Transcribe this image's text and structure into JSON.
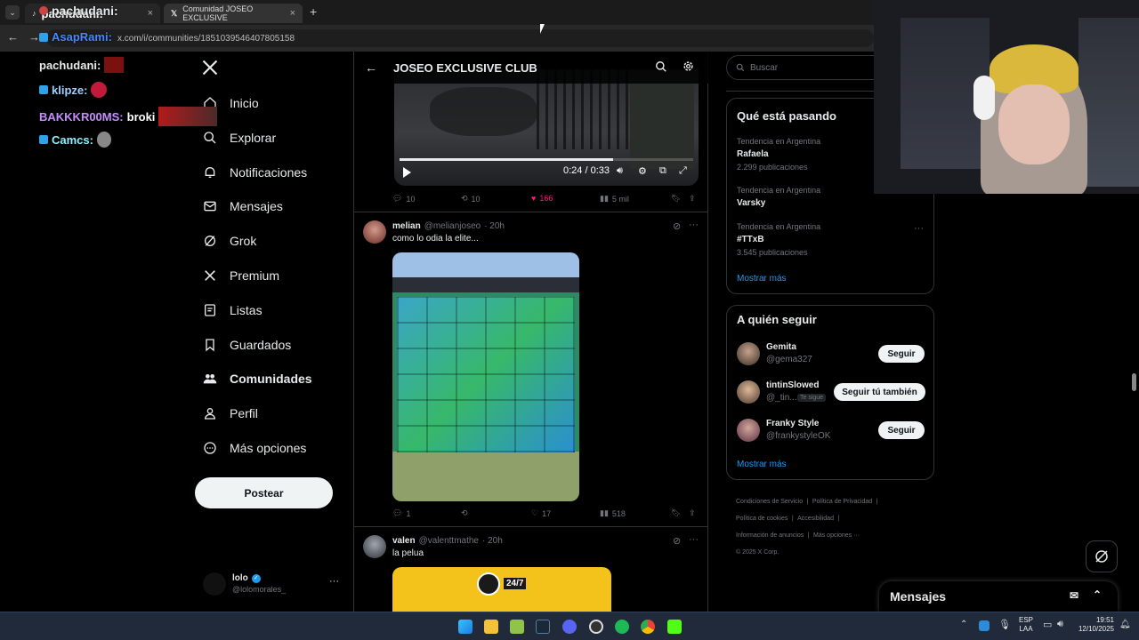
{
  "browser": {
    "tabs": [
      {
        "label": "pachudani:"
      },
      {
        "label": "Comunidad JOSEO EXCLUSIVE"
      }
    ],
    "new_tab": "+",
    "url": "x.com/i/communities/1851039546407805158"
  },
  "sidebar": {
    "logo": "X",
    "items": [
      {
        "label": "Inicio",
        "icon": "home-icon"
      },
      {
        "label": "Explorar",
        "icon": "search-icon"
      },
      {
        "label": "Notificaciones",
        "icon": "bell-icon"
      },
      {
        "label": "Mensajes",
        "icon": "mail-icon"
      },
      {
        "label": "Grok",
        "icon": "grok-icon"
      },
      {
        "label": "Premium",
        "icon": "x-icon"
      },
      {
        "label": "Listas",
        "icon": "list-icon"
      },
      {
        "label": "Guardados",
        "icon": "bookmark-icon"
      },
      {
        "label": "Comunidades",
        "icon": "communities-icon"
      },
      {
        "label": "Perfil",
        "icon": "person-icon"
      },
      {
        "label": "Más opciones",
        "icon": "more-circle-icon"
      }
    ],
    "post_button": "Postear",
    "account": {
      "name": "lolo",
      "handle": "@lolomorales_",
      "more": "···"
    }
  },
  "feed": {
    "header_title": "JOSEO EXCLUSIVE CLUB",
    "video": {
      "time": "0:24 / 0:33"
    },
    "first_post_actions": {
      "replies": "10",
      "reposts": "10",
      "likes": "166",
      "views": "5 mil"
    },
    "posts": [
      {
        "name": "melian",
        "handle": "@melianjoseo",
        "time": "· 20h",
        "text": "como lo odia la elite...",
        "actions": {
          "replies": "1",
          "reposts": "",
          "likes": "17",
          "views": "518"
        }
      },
      {
        "name": "valen",
        "handle": "@valenttmathe",
        "time": "· 20h",
        "text": "la pelua",
        "image_text": "24/7"
      }
    ]
  },
  "right": {
    "search_placeholder": "Buscar",
    "trends_title": "Qué está pasando",
    "trends": [
      {
        "context": "Tendencia en Argentina",
        "name": "Rafaela",
        "count": "2.299 publicaciones"
      },
      {
        "context": "Tendencia en Argentina",
        "name": "Varsky",
        "count": ""
      },
      {
        "context": "Tendencia en Argentina",
        "name": "#TTxB",
        "count": "3.545 publicaciones"
      }
    ],
    "show_more": "Mostrar más",
    "follow_title": "A quién seguir",
    "follow": [
      {
        "name": "Gemita",
        "handle": "@gema327",
        "button": "Seguir",
        "badge": ""
      },
      {
        "name": "tintinSlowed",
        "handle": "@_tin...",
        "button": "Seguir tú también",
        "badge": "Te sigue"
      },
      {
        "name": "Franky Style",
        "handle": "@frankystyleOK",
        "button": "Seguir",
        "badge": ""
      }
    ],
    "footer": [
      "Condiciones de Servicio",
      "Política de Privacidad",
      "Política de cookies",
      "Accesibilidad",
      "Información de anuncios",
      "Más opciones ···",
      "© 2025 X Corp."
    ],
    "messages_title": "Mensajes"
  },
  "chat_overlay": [
    {
      "user": "pachudani:",
      "color": "#e7e9ea"
    },
    {
      "user": "AsapRami:",
      "color": "#4a86ff"
    },
    {
      "user": "pachudani:",
      "color": "#e7e9ea"
    },
    {
      "user": "klipze:",
      "color": "#9fd0ff"
    },
    {
      "user": "BAKKKR00MS:",
      "color": "#c58cff",
      "message": "broki"
    },
    {
      "user": "Camcs:",
      "color": "#8ff0ff"
    }
  ],
  "taskbar": {
    "lang": "ESP",
    "lang2": "LAA",
    "time": "19:51",
    "date": "12/10/2025"
  },
  "colors": {
    "like_pink": "#f91880",
    "accent": "#1d9bf0"
  }
}
